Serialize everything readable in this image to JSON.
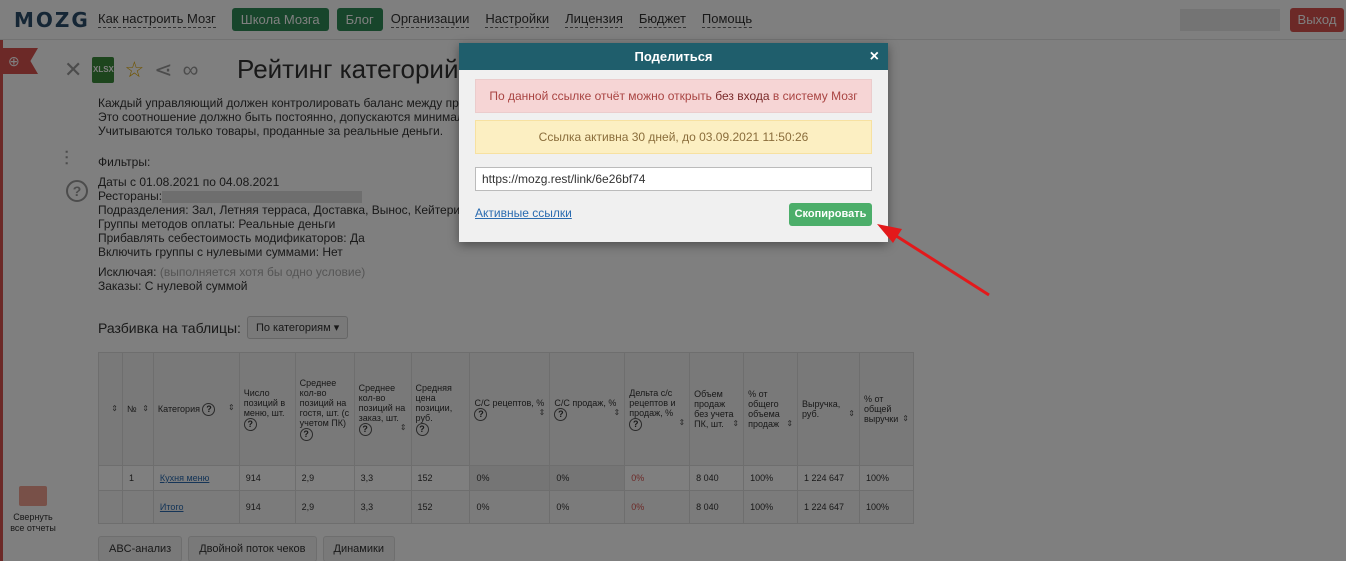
{
  "topbar": {
    "logo": "MOZG",
    "nav": {
      "how_to": "Как настроить Мозг",
      "school": "Школа Мозга",
      "blog": "Блог",
      "organizations": "Организации",
      "settings": "Настройки",
      "license": "Лицензия",
      "budget": "Бюджет",
      "help": "Помощь"
    },
    "exit": "Выход"
  },
  "page": {
    "title": "Рейтинг категорий и",
    "description": [
      "Каждый управляющий должен контролировать баланс между про",
      "Это соотношение должно быть постоянно, допускаются минимал",
      "Учитываются только товары, проданные за реальные деньги."
    ],
    "filters": {
      "heading": "Фильтры:",
      "dates": "Даты с 01.08.2021 по 04.08.2021",
      "restaurants_label": "Рестораны:",
      "divisions": "Подразделения: Зал, Летняя терраса, Доставка, Вынос, Кейтерин",
      "payment_groups": "Группы методов оплаты: Реальные деньги",
      "modifiers_cost": "Прибавлять себестоимость модификаторов: Да",
      "zero_groups": "Включить группы с нулевыми суммами: Нет",
      "exclude_label": "Исключая:",
      "exclude_note": "(выполняется хотя бы одно условие)",
      "orders": "Заказы: С нулевой суммой"
    },
    "breakdown": {
      "label": "Разбивка на таблицы:",
      "value": "По категориям"
    },
    "table": {
      "headers": [
        "№",
        "Категория",
        "Число позиций в меню, шт.",
        "Среднее кол-во позиций на гостя, шт. (с учетом ПК)",
        "Среднее кол-во позиций на заказ, шт.",
        "Средняя цена позиции, руб.",
        "С/С рецептов, %",
        "С/С продаж, %",
        "Дельта с/с рецептов и продаж, %",
        "Объем продаж без учета ПК, шт.",
        "% от общего объема продаж",
        "Выручка, руб.",
        "% от общей выручки"
      ],
      "rows": [
        [
          "1",
          "Кухня меню",
          "914",
          "2,9",
          "3,3",
          "152",
          "0%",
          "0%",
          "0%",
          "8 040",
          "100%",
          "1 224 647",
          "100%"
        ]
      ],
      "total": [
        "",
        "Итого",
        "914",
        "2,9",
        "3,3",
        "152",
        "0%",
        "0%",
        "0%",
        "8 040",
        "100%",
        "1 224 647",
        "100%"
      ]
    },
    "collapse_label": "Свернуть все отчеты",
    "bottom_tabs": [
      "ABC-анализ",
      "Двойной поток чеков",
      "Динамики"
    ]
  },
  "modal": {
    "title": "Поделиться",
    "close": "×",
    "alert_red_pre": "По данной ссылке отчёт можно открыть ",
    "alert_red_bold": "без входа",
    "alert_red_post": " в систему Мозг",
    "alert_yellow": "Ссылка активна 30 дней, до 03.09.2021 11:50:26",
    "link_value": "https://mozg.rest/link/6e26bf74",
    "active_links": "Активные ссылки",
    "copy_button": "Скопировать"
  },
  "colors": {
    "modal_header": "#1f5e6c",
    "copy_button": "#4cae6a",
    "accent_red": "#d9534f",
    "alert_red_bg": "#f6d5d5",
    "alert_yellow_bg": "#fcefc2",
    "arrow": "#e3191b"
  }
}
